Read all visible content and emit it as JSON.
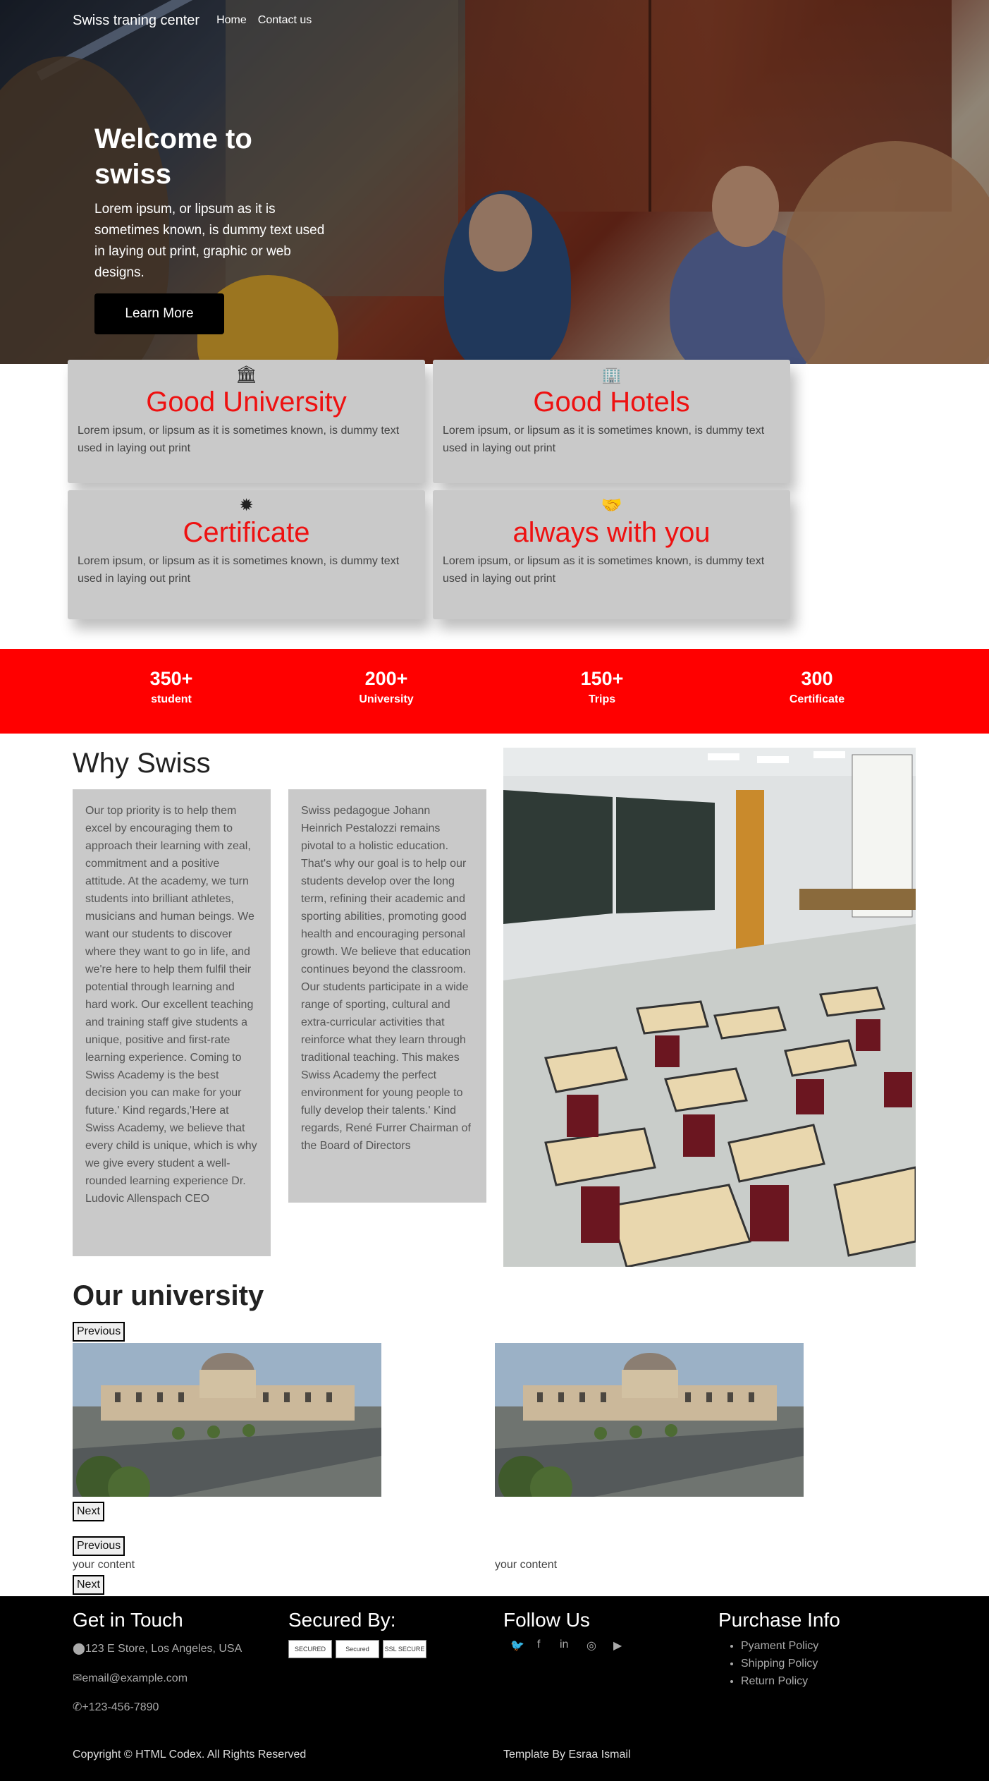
{
  "nav": {
    "brand": "Swiss traning center",
    "links": [
      "Home",
      "Contact us"
    ]
  },
  "hero": {
    "title": "Welcome to swiss",
    "text": "Lorem ipsum, or lipsum as it is sometimes known, is dummy text used in laying out print, graphic or web designs.",
    "button": "Learn More"
  },
  "features": [
    {
      "icon": "university-icon",
      "glyph": "🏛",
      "title": "Good University",
      "text": "Lorem ipsum, or lipsum as it is sometimes known, is dummy text used in laying out print"
    },
    {
      "icon": "hotel-icon",
      "glyph": "🏢",
      "title": "Good Hotels",
      "text": "Lorem ipsum, or lipsum as it is sometimes known, is dummy text used in laying out print"
    },
    {
      "icon": "certificate-icon",
      "glyph": "✹",
      "title": "Certificate",
      "text": "Lorem ipsum, or lipsum as it is sometimes known, is dummy text used in laying out print"
    },
    {
      "icon": "handshake-icon",
      "glyph": "🤝",
      "title": "always with you",
      "text": "Lorem ipsum, or lipsum as it is sometimes known, is dummy text used in laying out print"
    }
  ],
  "stats": [
    {
      "value": "350+",
      "label": "student"
    },
    {
      "value": "200+",
      "label": "University"
    },
    {
      "value": "150+",
      "label": "Trips"
    },
    {
      "value": "300",
      "label": "Certificate"
    }
  ],
  "why": {
    "title": "Why Swiss",
    "col1": "Our top priority is to help them excel by encouraging them to approach their learning with zeal, commitment and a positive attitude. At the academy, we turn students into brilliant athletes, musicians and human beings. We want our students to discover where they want to go in life, and we're here to help them fulfil their potential through learning and hard work. Our excellent teaching and training staff give students a unique, positive and first-rate learning experience. Coming to Swiss Academy is the best decision you can make for your future.' Kind regards,'Here at Swiss Academy, we believe that every child is unique, which is why we give every student a well-rounded learning experience Dr. Ludovic Allenspach CEO",
    "col2": "Swiss pedagogue Johann Heinrich Pestalozzi remains pivotal to a holistic education. That's why our goal is to help our students develop over the long term, refining their academic and sporting abilities, promoting good health and encouraging personal growth. We believe that education continues beyond the classroom. Our students participate in a wide range of sporting, cultural and extra-curricular activities that reinforce what they learn through traditional teaching. This makes Swiss Academy the perfect environment for young people to fully develop their talents.' Kind regards, René Furrer Chairman of the Board of Directors"
  },
  "university": {
    "title": "Our university",
    "prev": "Previous",
    "next": "Next",
    "content": "your content"
  },
  "footer": {
    "contact_title": "Get in Touch",
    "address": "123 E Store, Los Angeles, USA",
    "email": "email@example.com",
    "phone": "+123-456-7890",
    "secured_title": "Secured By:",
    "badges": [
      "SECURED",
      "Secured",
      "SSL SECURE"
    ],
    "follow_title": "Follow Us",
    "purchase_title": "Purchase Info",
    "policies": [
      "Pyament Policy",
      "Shipping Policy",
      "Return Policy"
    ],
    "copyright": "Copyright © HTML Codex. All Rights Reserved",
    "credit": "Template By Esraa Ismail"
  }
}
